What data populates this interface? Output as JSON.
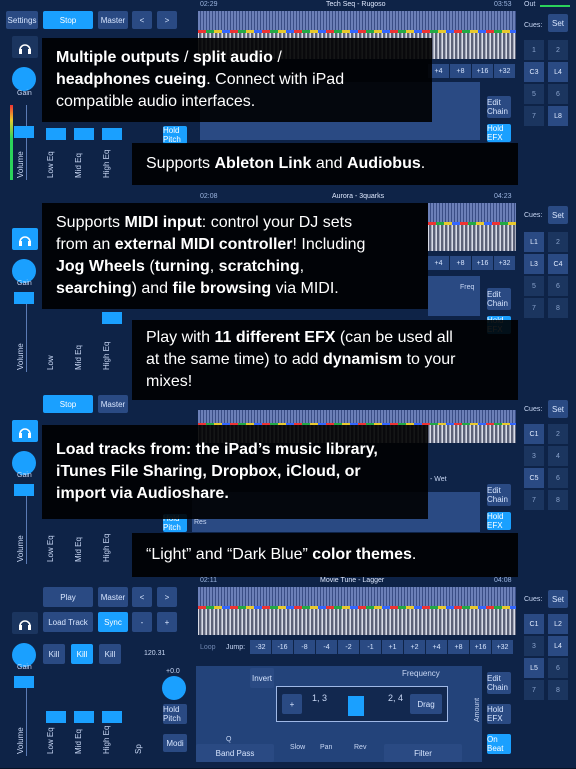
{
  "decks": [
    {
      "buttons": [
        "Settings",
        "Stop",
        "Master",
        "<",
        ">"
      ],
      "time_start": "02:29",
      "title": "Tech Seq - Rugoso",
      "time_end": "03:53",
      "out_label": "Out",
      "cues_label": "Cues:",
      "set_label": "Set",
      "cue_items": [
        "1",
        "2",
        "C3",
        "L4",
        "5",
        "6",
        "7",
        "L8"
      ],
      "jump_buttons": [
        "+4",
        "+8",
        "+16",
        "+32"
      ],
      "right_buttons": [
        "Edit Chain",
        "Hold EFX"
      ],
      "gain_label": "Gain",
      "volume_label": "Volume",
      "eq_labels": [
        "Low Eq",
        "Mid Eq",
        "High Eq"
      ],
      "hold_pitch": "Hold Pitch",
      "partial_labels": [
        "eq"
      ]
    },
    {
      "time_start": "02:08",
      "title": "Aurora - 3quarks",
      "time_end": "04:23",
      "cues_label": "Cues:",
      "set_label": "Set",
      "cue_items": [
        "L1",
        "2",
        "L3",
        "C4",
        "5",
        "6",
        "7",
        "8"
      ],
      "jump_buttons": [
        "+4",
        "+8",
        "+16",
        "+32"
      ],
      "right_buttons": [
        "Edit Chain",
        "Hold EFX"
      ],
      "gain_label": "Gain",
      "volume_label": "Volume",
      "eq_labels": [
        "Low",
        "Mid Eq",
        "High Eq"
      ],
      "partial_labels": [
        "Freq"
      ]
    },
    {
      "buttons": [
        "Stop",
        "Master"
      ],
      "cues_label": "Cues:",
      "set_label": "Set",
      "cue_items": [
        "C1",
        "2",
        "3",
        "4",
        "C5",
        "6",
        "7",
        "8"
      ],
      "right_buttons": [
        "Edit Chain",
        "Hold EFX"
      ],
      "gain_label": "Gain",
      "volume_label": "Volume",
      "eq_labels": [
        "Low Eq",
        "Mid Eq",
        "High Eq"
      ],
      "hold_pitch": "Hold Pitch",
      "partial_labels": [
        "- Wet",
        "Res"
      ]
    },
    {
      "buttons": [
        "Play",
        "Master",
        "<",
        ">",
        "Load Track",
        "Sync",
        "-",
        "+",
        "Kill",
        "Kill",
        "Kill"
      ],
      "time_start": "02:11",
      "title": "Movie Tune - Lagger",
      "time_end": "04:08",
      "bpm": "120.31",
      "pitch_range": "+0.0",
      "cues_label": "Cues:",
      "set_label": "Set",
      "cue_items": [
        "C1",
        "L2",
        "3",
        "L4",
        "L5",
        "6",
        "7",
        "8"
      ],
      "loop_label": "Loop",
      "jump_label": "Jump:",
      "jump_buttons": [
        "-32",
        "-16",
        "-8",
        "-4",
        "-2",
        "-1",
        "+1",
        "+2",
        "+4",
        "+8",
        "+16",
        "+32"
      ],
      "right_buttons": [
        "Edit Chain",
        "Hold EFX",
        "On Beat"
      ],
      "gain_label": "Gain",
      "volume_label": "Volume",
      "eq_labels": [
        "Low Eq",
        "Mid Eq",
        "High Eq",
        "Sp"
      ],
      "hold_pitch": "Hold Pitch",
      "modi": "Modi",
      "fx": {
        "invert": "Invert",
        "frequency": "Frequency",
        "amount": "Amount",
        "filter": "Filter",
        "band_pass": "Band Pass",
        "plus": "+",
        "val_a": "1, 3",
        "val_b": "2, 4",
        "drag": "Drag",
        "q": "Q",
        "slow": "Slow",
        "pan": "Pan",
        "rev": "Rev"
      }
    }
  ],
  "overlays": [
    {
      "parts": [
        [
          {
            "b": true,
            "t": "Multiple outputs"
          },
          {
            "b": false,
            "t": " / "
          },
          {
            "b": true,
            "t": "split audio"
          },
          {
            "b": false,
            "t": " /"
          }
        ],
        [
          {
            "b": true,
            "t": "headphones cueing"
          },
          {
            "b": false,
            "t": ". Connect with iPad"
          }
        ],
        [
          {
            "b": false,
            "t": "compatible audio interfaces."
          }
        ]
      ]
    },
    {
      "parts": [
        [
          {
            "b": false,
            "t": "Supports "
          },
          {
            "b": true,
            "t": "Ableton Link"
          },
          {
            "b": false,
            "t": " and "
          },
          {
            "b": true,
            "t": "Audiobus"
          },
          {
            "b": false,
            "t": "."
          }
        ]
      ]
    },
    {
      "parts": [
        [
          {
            "b": false,
            "t": "Supports "
          },
          {
            "b": true,
            "t": "MIDI input"
          },
          {
            "b": false,
            "t": ": control your DJ sets"
          }
        ],
        [
          {
            "b": false,
            "t": "from an "
          },
          {
            "b": true,
            "t": "external MIDI controller"
          },
          {
            "b": false,
            "t": "! Including"
          }
        ],
        [
          {
            "b": true,
            "t": "Jog Wheels"
          },
          {
            "b": false,
            "t": " ("
          },
          {
            "b": true,
            "t": "turning"
          },
          {
            "b": false,
            "t": ", "
          },
          {
            "b": true,
            "t": "scratching"
          },
          {
            "b": false,
            "t": ","
          }
        ],
        [
          {
            "b": true,
            "t": "searching"
          },
          {
            "b": false,
            "t": ") and "
          },
          {
            "b": true,
            "t": "file browsing"
          },
          {
            "b": false,
            "t": " via MIDI."
          }
        ]
      ]
    },
    {
      "parts": [
        [
          {
            "b": false,
            "t": "Play with "
          },
          {
            "b": true,
            "t": "11 different EFX"
          },
          {
            "b": false,
            "t": " (can be used all"
          }
        ],
        [
          {
            "b": false,
            "t": "at the same time) to add "
          },
          {
            "b": true,
            "t": "dynamism"
          },
          {
            "b": false,
            "t": " to your"
          }
        ],
        [
          {
            "b": false,
            "t": "mixes!"
          }
        ]
      ]
    },
    {
      "parts": [
        [
          {
            "b": true,
            "t": "Load tracks from: the iPad’s music library,"
          }
        ],
        [
          {
            "b": true,
            "t": "iTunes File Sharing, Dropbox, iCloud, or"
          }
        ],
        [
          {
            "b": true,
            "t": "import via Audioshare."
          }
        ]
      ]
    },
    {
      "parts": [
        [
          {
            "b": false,
            "t": "“Light” and “Dark Blue” "
          },
          {
            "b": true,
            "t": "color themes"
          },
          {
            "b": false,
            "t": "."
          }
        ]
      ]
    }
  ]
}
